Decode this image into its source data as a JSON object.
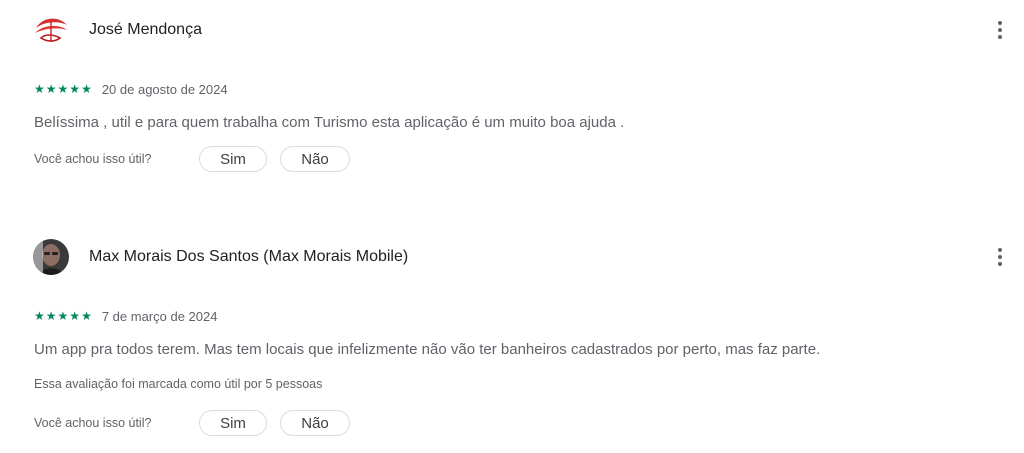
{
  "reviews": [
    {
      "author": "José Mendonça",
      "rating": 5,
      "stars": [
        "★",
        "★",
        "★",
        "★",
        "★"
      ],
      "date": "20 de agosto de 2024",
      "text": "Belíssima , util e para quem trabalha com Turismo esta aplicação é um muito boa ajuda .",
      "helpful_count_text": "",
      "helpful_question": "Você achou isso útil?",
      "yes_label": "Sim",
      "no_label": "Não"
    },
    {
      "author": "Max Morais Dos Santos (Max Morais Mobile)",
      "rating": 5,
      "stars": [
        "★",
        "★",
        "★",
        "★",
        "★"
      ],
      "date": "7 de março de 2024",
      "text": "Um app pra todos terem. Mas tem locais que infelizmente não vão ter banheiros cadastrados por perto, mas faz parte.",
      "helpful_count_text": "Essa avaliação foi marcada como útil por 5 pessoas",
      "helpful_question": "Você achou isso útil?",
      "yes_label": "Sim",
      "no_label": "Não"
    }
  ],
  "colors": {
    "star": "#01875f",
    "muted_text": "#5f6368",
    "border": "#dadce0"
  },
  "icons": {
    "more": "more-vert-icon",
    "star": "star-icon"
  }
}
